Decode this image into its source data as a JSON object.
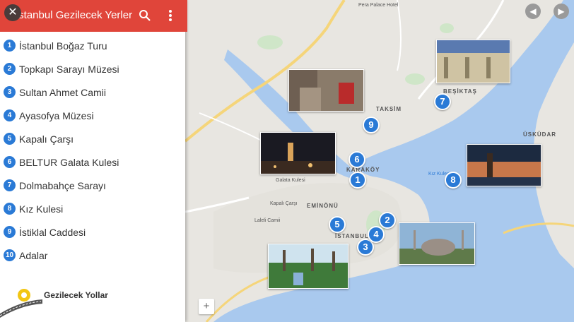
{
  "header": {
    "title": "İstanbul Gezilecek Yerler",
    "close_icon": "close-icon",
    "search_icon": "search-icon",
    "more_icon": "more-vert-icon"
  },
  "places": [
    {
      "num": "1",
      "label": "İstanbul Boğaz Turu"
    },
    {
      "num": "2",
      "label": "Topkapı Sarayı Müzesi"
    },
    {
      "num": "3",
      "label": "Sultan Ahmet Camii"
    },
    {
      "num": "4",
      "label": "Ayasofya Müzesi"
    },
    {
      "num": "5",
      "label": "Kapalı Çarşı"
    },
    {
      "num": "6",
      "label": "BELTUR Galata Kulesi"
    },
    {
      "num": "7",
      "label": "Dolmabahçe Sarayı"
    },
    {
      "num": "8",
      "label": "Kız Kulesi"
    },
    {
      "num": "9",
      "label": "İstiklal Caddesi"
    },
    {
      "num": "10",
      "label": "Adalar"
    }
  ],
  "logo": {
    "text": "Gezilecek Yollar"
  },
  "map": {
    "districts": [
      "KARAKÖY",
      "EMİNÖNÜ",
      "İSTANBUL",
      "ÜSKÜDAR",
      "BEŞİKTAŞ",
      "TAKSİM"
    ],
    "place_labels": [
      "Pera Palace Hotel",
      "Kız Kulesi",
      "Kapalı Çarşı",
      "Laleli Camii",
      "Galata Kulesi"
    ],
    "pins": [
      "1",
      "2",
      "3",
      "4",
      "5",
      "6",
      "7",
      "8",
      "9"
    ],
    "zoom_label": "+",
    "prev_icon": "chevron-left-icon",
    "next_icon": "chevron-right-icon"
  },
  "colors": {
    "header": "#e0453a",
    "pin": "#2a7ad6",
    "water": "#a9c9ee",
    "land": "#e8e6e1"
  }
}
